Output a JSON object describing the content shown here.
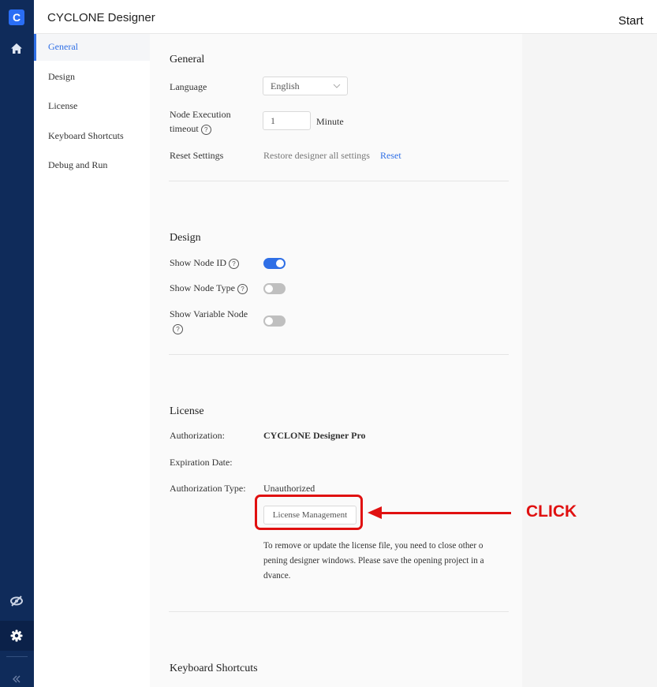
{
  "rail": {
    "logo_letter": "C",
    "icons": [
      "home-icon",
      "eye-off-icon",
      "gear-icon",
      "collapse-icon"
    ]
  },
  "titlebar": {
    "app_title": "CYCLONE Designer",
    "tab_label": "Start"
  },
  "nav": {
    "items": [
      {
        "label": "General",
        "active": true
      },
      {
        "label": "Design",
        "active": false
      },
      {
        "label": "License",
        "active": false
      },
      {
        "label": "Keyboard Shortcuts",
        "active": false
      },
      {
        "label": "Debug and Run",
        "active": false
      }
    ],
    "accent_color": "#2f6fe6"
  },
  "general": {
    "title": "General",
    "language_label": "Language",
    "language_value": "English",
    "timeout_label_line1": "Node Execution",
    "timeout_label_line2": "timeout",
    "timeout_value": "1",
    "timeout_unit": "Minute",
    "reset_label": "Reset Settings",
    "reset_desc": "Restore designer all settings",
    "reset_link": "Reset"
  },
  "design": {
    "title": "Design",
    "show_node_id_label": "Show Node ID",
    "show_node_id_on": true,
    "show_node_type_label": "Show Node Type",
    "show_node_type_on": false,
    "show_variable_node_label": "Show Variable Node",
    "show_variable_node_on": false
  },
  "license": {
    "title": "License",
    "authorization_label": "Authorization:",
    "authorization_value": "CYCLONE Designer Pro",
    "expiration_label": "Expiration Date:",
    "expiration_value": "",
    "auth_type_label": "Authorization Type:",
    "auth_type_value": "Unauthorized",
    "manage_button": "License Management",
    "note_line1": "To remove or update the license file, you need to close other o",
    "note_line2": "pening designer windows. Please save the opening project in a",
    "note_line3": "dvance."
  },
  "shortcuts": {
    "title": "Keyboard Shortcuts"
  },
  "annotation": {
    "text": "CLICK",
    "color": "#e01010"
  }
}
